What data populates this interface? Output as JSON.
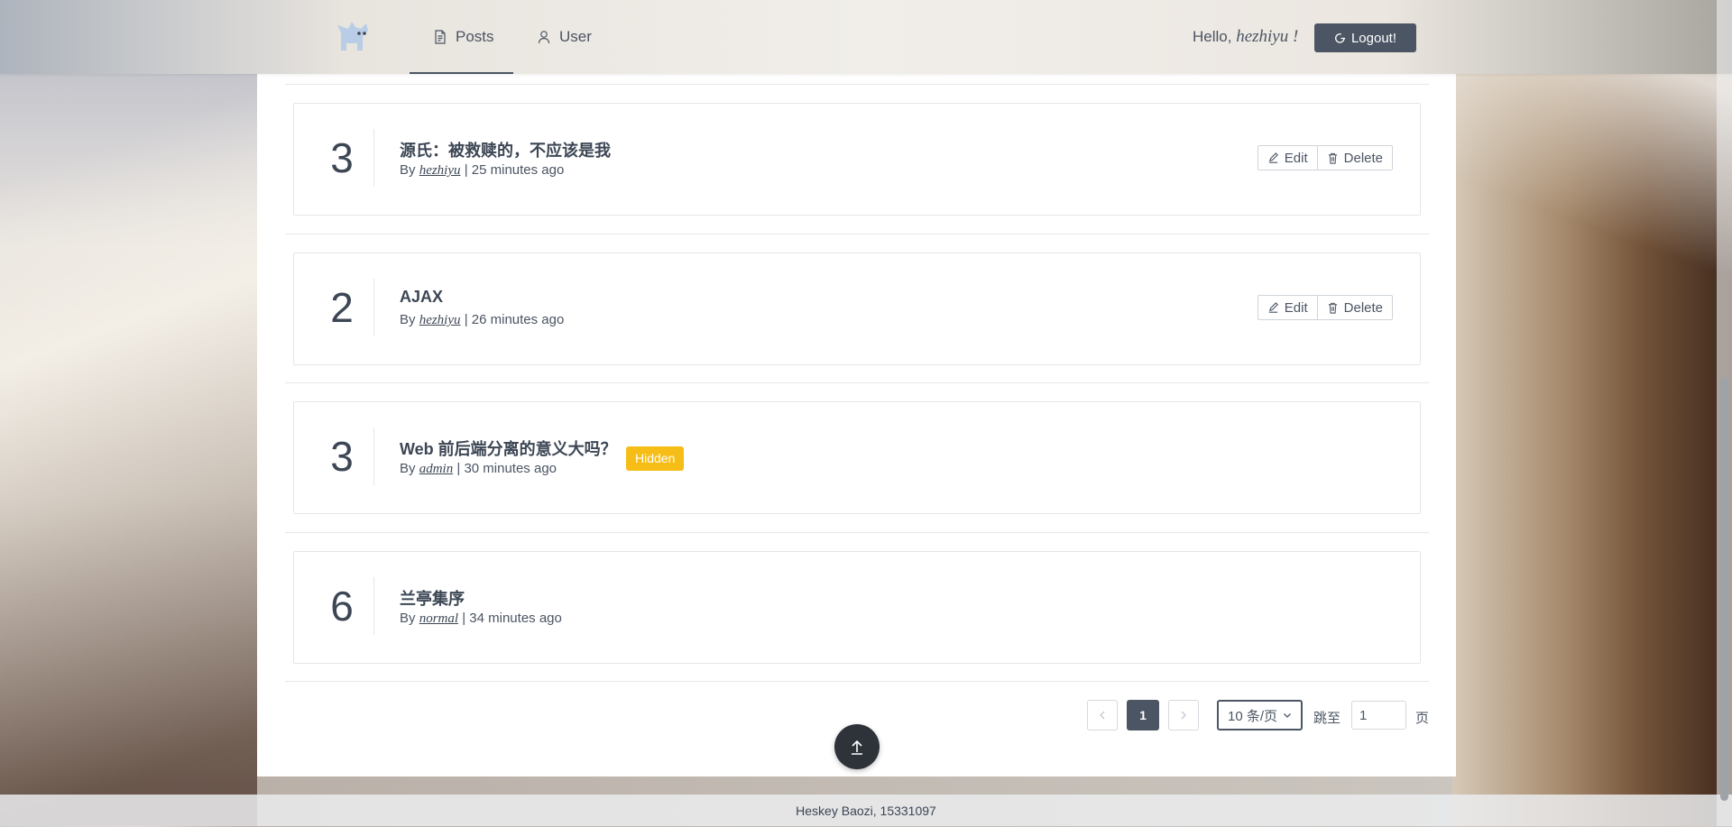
{
  "nav": {
    "tabs": [
      {
        "label": "Posts",
        "icon": "document-icon"
      },
      {
        "label": "User",
        "icon": "user-icon"
      }
    ],
    "hello_prefix": "Hello,",
    "username": "hezhiyu !",
    "logout_label": "Logout!"
  },
  "posts": [
    {
      "number": "3",
      "title": "源氏：被救赎的，不应该是我",
      "by": "By",
      "author": "hezhiyu",
      "sep": "|",
      "time": "25 minutes ago",
      "actions": {
        "edit": "Edit",
        "delete": "Delete"
      }
    },
    {
      "number": "2",
      "title": "AJAX",
      "by": "By",
      "author": "hezhiyu",
      "sep": "|",
      "time": "26 minutes ago",
      "actions": {
        "edit": "Edit",
        "delete": "Delete"
      }
    },
    {
      "number": "3",
      "title": "Web 前后端分离的意义大吗？",
      "by": "By",
      "author": "admin",
      "sep": "|",
      "time": "30 minutes ago",
      "badge": "Hidden"
    },
    {
      "number": "6",
      "title": "兰亭集序",
      "by": "By",
      "author": "normal",
      "sep": "|",
      "time": "34 minutes ago"
    }
  ],
  "pagination": {
    "current_page": "1",
    "page_size": "10 条/页",
    "goto_label": "跳至",
    "goto_value": "1",
    "page_unit": "页"
  },
  "footer": {
    "text": "Heskey Baozi, 15331097"
  },
  "colors": {
    "primary": "#4b5563",
    "badge": "#f6bd16",
    "back_top": "#2d3339"
  }
}
